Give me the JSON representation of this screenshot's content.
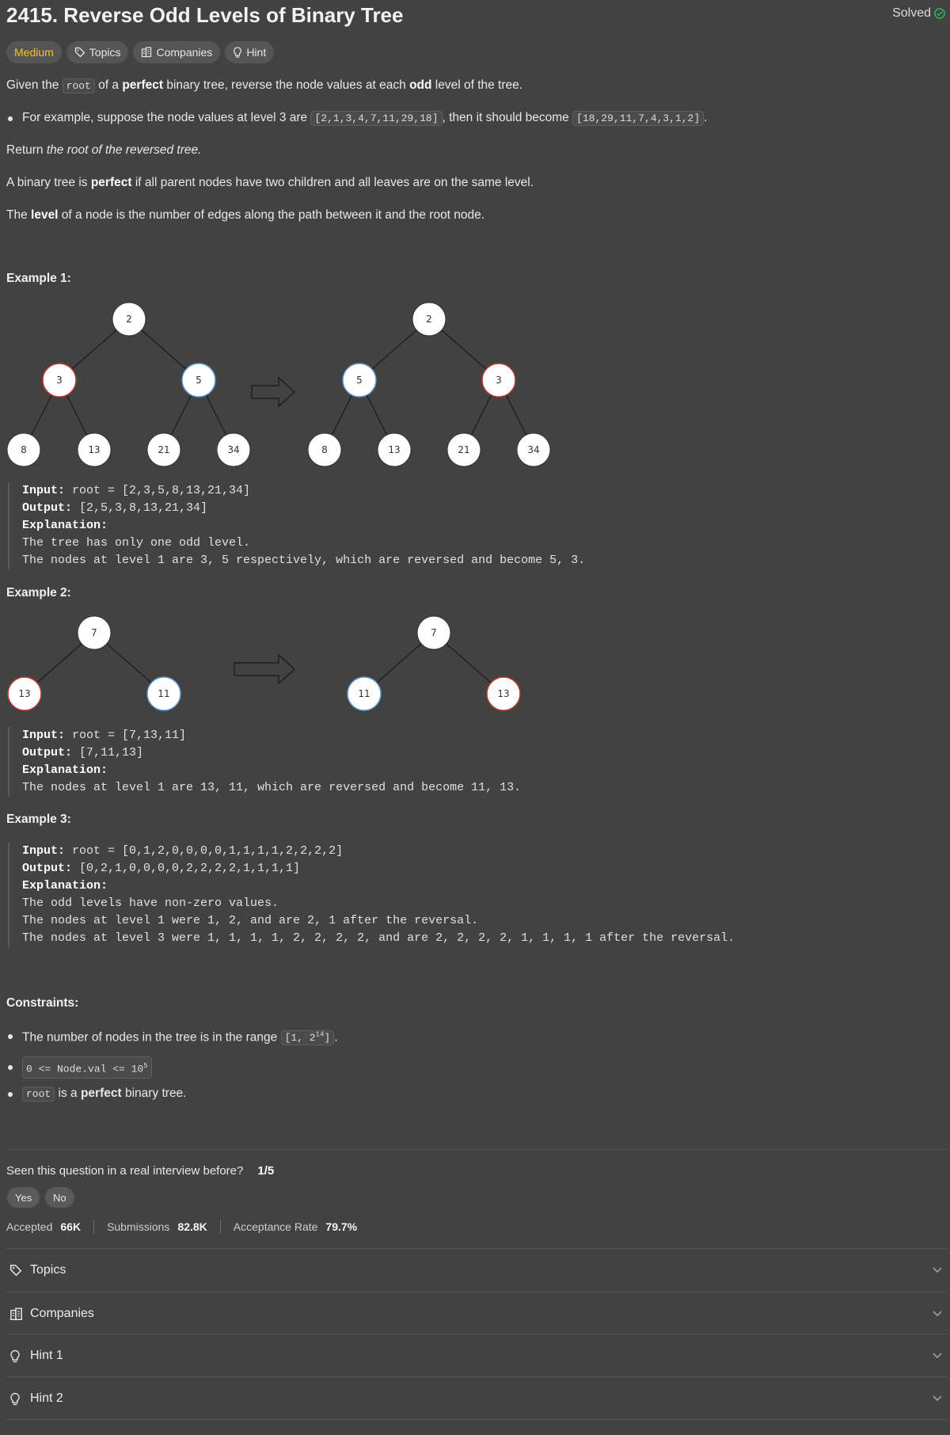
{
  "header": {
    "title": "2415. Reverse Odd Levels of Binary Tree",
    "solved_label": "Solved"
  },
  "tags": {
    "difficulty": "Medium",
    "topics": "Topics",
    "companies": "Companies",
    "hint": "Hint"
  },
  "description": {
    "p1_a": "Given the ",
    "p1_code": "root",
    "p1_b": " of a ",
    "p1_bold": "perfect",
    "p1_c": " binary tree, reverse the node values at each ",
    "p1_bold2": "odd",
    "p1_d": " level of the tree.",
    "b1_a": "For example, suppose the node values at level 3 are ",
    "b1_code1": "[2,1,3,4,7,11,29,18]",
    "b1_b": ", then it should become ",
    "b1_code2": "[18,29,11,7,4,3,1,2]",
    "b1_c": ".",
    "p2_a": "Return ",
    "p2_i": "the root of the reversed tree.",
    "p3_a": "A binary tree is ",
    "p3_bold": "perfect",
    "p3_b": " if all parent nodes have two children and all leaves are on the same level.",
    "p4_a": "The ",
    "p4_bold": "level",
    "p4_b": " of a node is the number of edges along the path between it and the root node."
  },
  "examples": [
    {
      "label": "Example 1:",
      "input_label": "Input:",
      "input": " root = [2,3,5,8,13,21,34]",
      "output_label": "Output:",
      "output": " [2,5,3,8,13,21,34]",
      "expl_label": "Explanation:",
      "lines": [
        "The tree has only one odd level.",
        "The nodes at level 1 are 3, 5 respectively, which are reversed and become 5, 3."
      ]
    },
    {
      "label": "Example 2:",
      "input_label": "Input:",
      "input": " root = [7,13,11]",
      "output_label": "Output:",
      "output": " [7,11,13]",
      "expl_label": "Explanation:",
      "lines": [
        "The nodes at level 1 are 13, 11, which are reversed and become 11, 13."
      ]
    },
    {
      "label": "Example 3:",
      "input_label": "Input:",
      "input": " root = [0,1,2,0,0,0,0,1,1,1,1,2,2,2,2]",
      "output_label": "Output:",
      "output": " [0,2,1,0,0,0,0,2,2,2,2,1,1,1,1]",
      "expl_label": "Explanation:",
      "lines": [
        "The odd levels have non-zero values.",
        "The nodes at level 1 were 1, 2, and are 2, 1 after the reversal.",
        "The nodes at level 3 were 1, 1, 1, 1, 2, 2, 2, 2, and are 2, 2, 2, 2, 1, 1, 1, 1 after the reversal."
      ]
    }
  ],
  "trees": {
    "ex1_left": {
      "root": "2",
      "l1": [
        "3",
        "5"
      ],
      "l2": [
        "8",
        "13",
        "21",
        "34"
      ]
    },
    "ex1_right": {
      "root": "2",
      "l1": [
        "5",
        "3"
      ],
      "l2": [
        "8",
        "13",
        "21",
        "34"
      ]
    },
    "ex2_left": {
      "root": "7",
      "l1": [
        "13",
        "11"
      ]
    },
    "ex2_right": {
      "root": "7",
      "l1": [
        "11",
        "13"
      ]
    }
  },
  "colors": {
    "red_node": "#c0392b",
    "blue_node": "#5b9bd5",
    "accent_green": "#2cbb5d",
    "medium": "#ffc01e"
  },
  "constraints": {
    "label": "Constraints:",
    "c1_a": "The number of nodes in the tree is in the range ",
    "c1_code": "[1, 2",
    "c1_sup": "14",
    "c1_code_end": "]",
    "c1_b": ".",
    "c2_code": "0 <= Node.val <= 10",
    "c2_sup": "5",
    "c3_code": "root",
    "c3_a": " is a ",
    "c3_bold": "perfect",
    "c3_b": " binary tree."
  },
  "interview": {
    "question": "Seen this question in a real interview before?",
    "ratio": "1/5",
    "yes": "Yes",
    "no": "No"
  },
  "stats": {
    "accepted_label": "Accepted",
    "accepted": "66K",
    "submissions_label": "Submissions",
    "submissions": "82.8K",
    "rate_label": "Acceptance Rate",
    "rate": "79.7%"
  },
  "accordion": [
    {
      "label": "Topics",
      "icon": "tag-icon"
    },
    {
      "label": "Companies",
      "icon": "building-icon"
    },
    {
      "label": "Hint 1",
      "icon": "lightbulb-icon"
    },
    {
      "label": "Hint 2",
      "icon": "lightbulb-icon"
    }
  ]
}
